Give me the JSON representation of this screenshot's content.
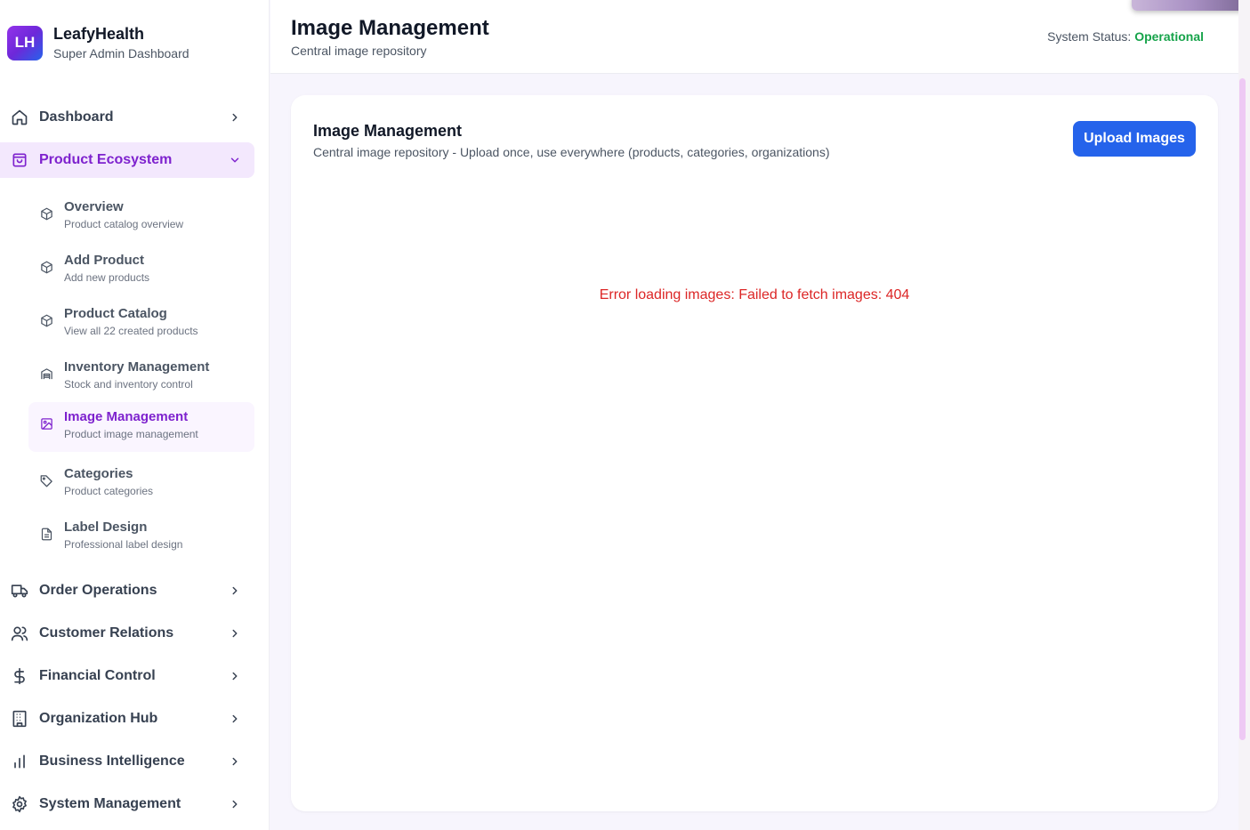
{
  "brand": {
    "logo_text": "LH",
    "name": "LeafyHealth",
    "subtitle": "Super Admin Dashboard"
  },
  "sidebar": {
    "items": [
      {
        "label": "Dashboard",
        "icon": "home-icon"
      },
      {
        "label": "Product Ecosystem",
        "icon": "shopping-bag-icon",
        "active": true,
        "expanded": true
      },
      {
        "label": "Order Operations",
        "icon": "truck-icon"
      },
      {
        "label": "Customer Relations",
        "icon": "users-icon"
      },
      {
        "label": "Financial Control",
        "icon": "dollar-icon"
      },
      {
        "label": "Organization Hub",
        "icon": "building-icon"
      },
      {
        "label": "Business Intelligence",
        "icon": "bar-chart-icon"
      },
      {
        "label": "System Management",
        "icon": "gear-icon"
      }
    ],
    "sub_items": [
      {
        "label": "Overview",
        "desc": "Product catalog overview",
        "icon": "package-icon"
      },
      {
        "label": "Add Product",
        "desc": "Add new products",
        "icon": "package-icon"
      },
      {
        "label": "Product Catalog",
        "desc": "View all 22 created products",
        "icon": "package-icon"
      },
      {
        "label": "Inventory Management",
        "desc": "Stock and inventory control",
        "icon": "warehouse-icon"
      },
      {
        "label": "Image Management",
        "desc": "Product image management",
        "icon": "image-icon",
        "active": true
      },
      {
        "label": "Categories",
        "desc": "Product categories",
        "icon": "tag-icon"
      },
      {
        "label": "Label Design",
        "desc": "Professional label design",
        "icon": "file-text-icon"
      }
    ]
  },
  "header": {
    "title": "Image Management",
    "subtitle": "Central image repository",
    "status_label": "System Status:",
    "status_value": "Operational"
  },
  "card": {
    "title": "Image Management",
    "subtitle": "Central image repository - Upload once, use everywhere (products, categories, organizations)",
    "upload_label": "Upload Images",
    "error": "Error loading images: Failed to fetch images: 404"
  },
  "colors": {
    "accent_purple": "#7e22ce",
    "primary_blue": "#2563eb",
    "status_green": "#16a34a",
    "error_red": "#dc2626"
  }
}
